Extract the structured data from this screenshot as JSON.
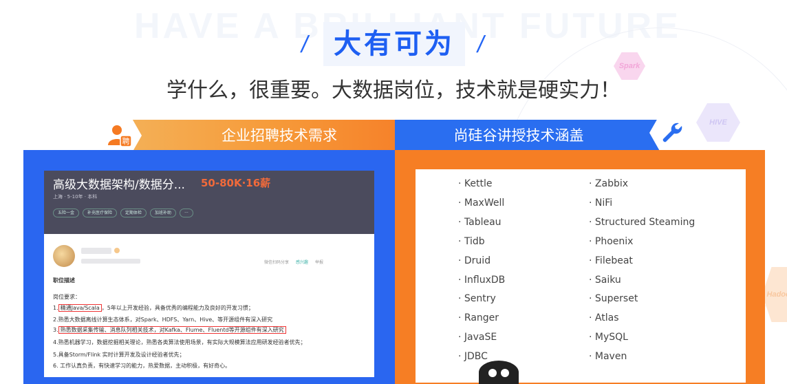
{
  "hero": {
    "bg_text": "HAVE A BRILLIANT FUTURE",
    "slash_left": "/",
    "slash_right": "/",
    "title": "大有可为",
    "subtitle": "学什么，很重要。大数据岗位，技术就是硬实力！"
  },
  "deco_hexes": {
    "spark": "Spark",
    "hive": "HIVE",
    "hadoop": "Hadoop"
  },
  "left_panel": {
    "header": "企业招聘技术需求",
    "badge_char": "聘",
    "job": {
      "title": "高级大数据架构/数据分...",
      "salary": "50-80K·16薪",
      "location": "上海 · 5-10年 · 本科",
      "tags": [
        "五险一金",
        "补充医疗保险",
        "定期体检",
        "加班补助",
        "···"
      ],
      "actions": [
        "微信扫码分享",
        "感兴趣",
        "举报"
      ],
      "section_label": "职位描述",
      "req_title": "岗位要求：",
      "requirements": [
        {
          "pre": "1.",
          "hl": "精通Java/Scala",
          "post": "，5年以上开发经验，具备优秀的编程能力及良好的开发习惯；"
        },
        {
          "pre": "2.熟悉大数据离线计算生态体系，对Spark、HDFS、Yarn、Hive、等开源组件有深入研究",
          "hl": "",
          "post": ""
        },
        {
          "pre": "3.",
          "hl": "熟悉数据采集传输、消息队列相关技术，对Kafka、Flume、Fluentd等开源组件有深入研究",
          "post": ""
        },
        {
          "pre": "4.熟悉机器学习，数据挖掘相关理论，熟悉各类算法使用场景，有实际大规模算法应用研发经验者优先；",
          "hl": "",
          "post": ""
        },
        {
          "pre": "5.具备Storm/Flink 实时计算开发及设计经验者优先；",
          "hl": "",
          "post": ""
        },
        {
          "pre": "6. 工作认真负责，有快速学习的能力，热爱数据，主动积极，有好奇心。",
          "hl": "",
          "post": ""
        }
      ]
    }
  },
  "right_panel": {
    "header": "尚硅谷讲授技术涵盖",
    "col1": [
      "· Kettle",
      "· MaxWell",
      "· Tableau",
      "· Tidb",
      "· Druid",
      "· InfluxDB",
      "· Sentry",
      "· Ranger",
      "· JavaSE",
      "· JDBC"
    ],
    "col2": [
      "· Zabbix",
      "· NiFi",
      "· Structured Steaming",
      "· Phoenix",
      "· Filebeat",
      "· Saiku",
      "· Superset",
      "· Atlas",
      "· MySQL",
      "· Maven"
    ]
  },
  "colors": {
    "blue": "#2a66f0",
    "orange": "#f67e24",
    "salary": "#f26a3a",
    "highlight_box": "#ee3333"
  }
}
